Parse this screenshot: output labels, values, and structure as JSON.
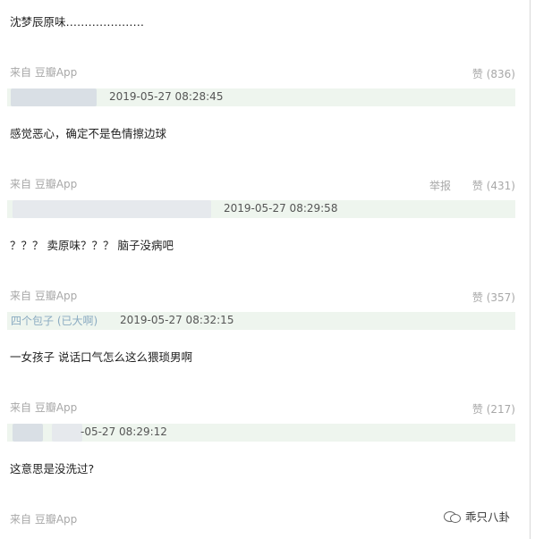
{
  "header_text": "沈梦辰原味…………………",
  "comments": [
    {
      "source": "来自 豆瓣App",
      "likes": "赞 (836)",
      "report": "",
      "user": "",
      "timestamp": "2019-05-27 08:28:45",
      "next_text": "感觉恶心，确定不是色情擦边球"
    },
    {
      "source": "来自 豆瓣App",
      "likes": "赞 (431)",
      "report": "举报",
      "user": "",
      "timestamp": "2019-05-27 08:29:58",
      "next_text": "？？？ 卖原味？？？ 脑子没病吧"
    },
    {
      "source": "来自 豆瓣App",
      "likes": "赞 (357)",
      "report": "",
      "user": "四个包子 (已大啊)",
      "timestamp": "2019-05-27 08:32:15",
      "next_text": "一女孩子 说话口气怎么这么猥琐男啊"
    },
    {
      "source": "来自 豆瓣App",
      "likes": "赞 (217)",
      "report": "",
      "user": "",
      "timestamp": "-05-27 08:29:12",
      "next_text": "这意思是没洗过?"
    }
  ],
  "footer": {
    "source": "来自 豆瓣App",
    "watermark": "乖只八卦",
    "icon": "wechat-icon"
  }
}
